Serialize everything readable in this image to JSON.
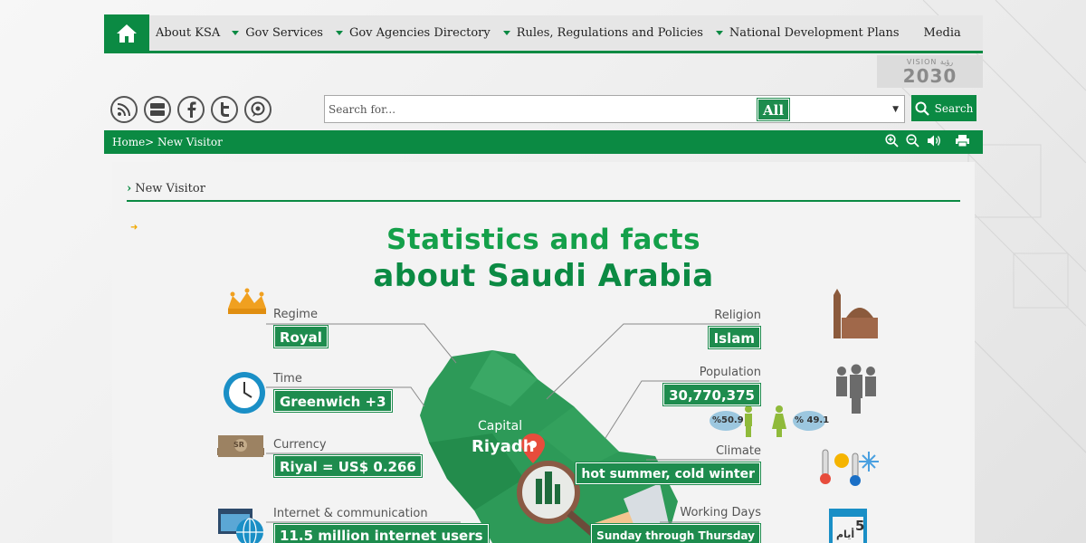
{
  "nav": {
    "items": [
      {
        "label": "About KSA",
        "caret": false
      },
      {
        "label": "Gov Services",
        "caret": true
      },
      {
        "label": "Gov Agencies Directory",
        "caret": true
      },
      {
        "label": "Rules, Regulations and Policies",
        "caret": true
      },
      {
        "label": "National Development Plans",
        "caret": true
      },
      {
        "label": "Media",
        "caret": false
      }
    ]
  },
  "vision": {
    "small": "VISION رؤية",
    "big": "2030"
  },
  "social": [
    "rss-icon",
    "youtube-icon",
    "facebook-icon",
    "twitter-icon",
    "chat-icon"
  ],
  "search": {
    "placeholder": "Search for...",
    "scope": "All",
    "button": "Search"
  },
  "breadcrumb": "Home> New Visitor",
  "panel_title": "New Visitor",
  "infographic": {
    "title1": "Statistics and facts",
    "title2": "about Saudi Arabia",
    "regime_label": "Regime",
    "regime_value": "Royal",
    "time_label": "Time",
    "time_value": "Greenwich +3",
    "currency_label": "Currency",
    "currency_value": "Riyal = US$ 0.266",
    "internet_label": "Internet & communication",
    "internet_value": "11.5 million internet users",
    "religion_label": "Religion",
    "religion_value": "Islam",
    "population_label": "Population",
    "population_value": "30,770,375",
    "male_pct": "%50.9",
    "female_pct": "% 49.1",
    "climate_label": "Climate",
    "climate_value": "hot summer, cold winter",
    "working_label": "Working Days",
    "working_value": "Sunday through Thursday",
    "capital_label": "Capital",
    "capital_value": "Riyadh",
    "calendar_number": "5",
    "calendar_text": "أيام",
    "currency_note_symbol": "SR"
  },
  "colors": {
    "brand_green": "#0b8a43",
    "box_green": "#1e8c4e",
    "title_green": "#14a04a"
  }
}
